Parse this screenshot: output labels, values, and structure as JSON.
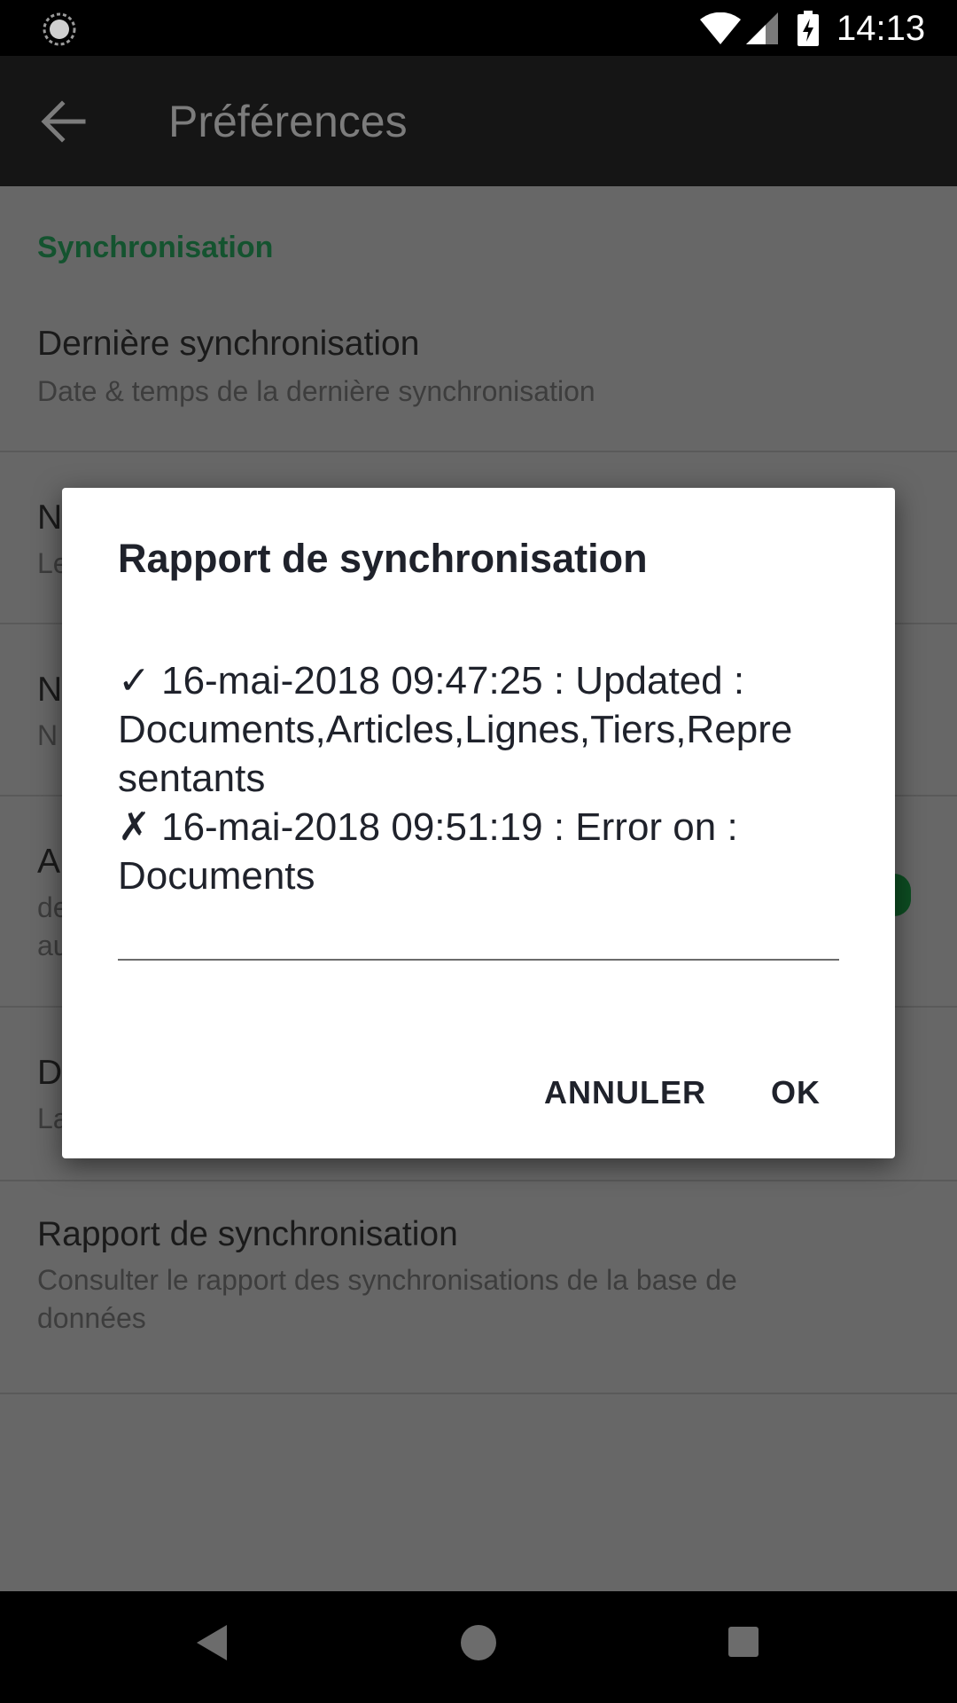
{
  "status_bar": {
    "time": "14:13",
    "icons": [
      "sync-icon",
      "wifi-icon",
      "signal-icon",
      "battery-charging-icon"
    ]
  },
  "app_bar": {
    "title": "Préférences",
    "back_icon": "arrow-back-icon"
  },
  "preferences": {
    "section": "Synchronisation",
    "items": [
      {
        "title": "Dernière synchronisation",
        "summary": "Date & temps de la dernière synchronisation"
      },
      {
        "title": "N",
        "summary": "Le"
      },
      {
        "title": "N",
        "summary": "N"
      },
      {
        "title": "A",
        "summary": "de",
        "summary2": "au",
        "toggle": true
      },
      {
        "title": "D",
        "summary": "La"
      },
      {
        "title": "Rapport de synchronisation",
        "summary": "Consulter le rapport des synchronisations de la base de",
        "summary2": "données"
      }
    ]
  },
  "dialog": {
    "title": "Rapport de synchronisation",
    "lines": [
      "✓ 16-mai-2018 09:47:25 : Updated :",
      "Documents,Articles,Lignes,Tiers,Repre",
      "sentants",
      "✗ 16-mai-2018 09:51:19 : Error on :",
      "Documents"
    ],
    "cancel_label": "ANNULER",
    "ok_label": "OK"
  },
  "nav_bar": {
    "icons": [
      "nav-back-icon",
      "nav-home-icon",
      "nav-recents-icon"
    ]
  },
  "colors": {
    "accent": "#0d4d22",
    "scrim_background": "#676767",
    "dialog_background": "#ffffff"
  }
}
